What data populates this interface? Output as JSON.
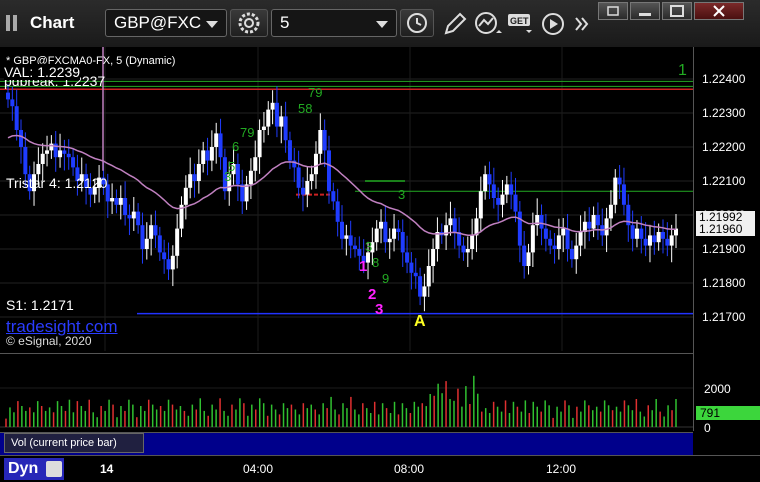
{
  "window": {
    "title": "Chart"
  },
  "toolbar": {
    "symbol": "GBP@FXC",
    "interval": "5"
  },
  "chart": {
    "title": "* GBP@FXCMA0-FX, 5 (Dynamic)",
    "labels": {
      "val": "VAL: 1.2239",
      "pdbreak": "pdbreak: 1.2237",
      "tristar": "Tristar 4: 1.2120",
      "s1": "S1: 1.2171",
      "brand": "tradesight.com",
      "copyright": "© eSignal, 2020",
      "marker_a": "A",
      "marker_1": "1",
      "marker_2": "2",
      "marker_3": "3",
      "green_marker": "1",
      "bar_count_marks": [
        "79",
        "58",
        "79",
        "6",
        "5",
        "3",
        "3",
        "8",
        "9",
        "3"
      ]
    },
    "price_ticks": [
      "1.22400",
      "1.22300",
      "1.22200",
      "1.22100",
      "1.22000",
      "1.21900",
      "1.21800",
      "1.21700"
    ],
    "last_price": "1.21960",
    "ma_price": "1.21992",
    "volume_ticks": [
      "2000",
      "0"
    ],
    "last_volume": "791",
    "volume_label": "Vol (current price bar)",
    "time_ticks": [
      "14",
      "04:00",
      "08:00",
      "12:00"
    ],
    "footer_label": "Dyn",
    "colors": {
      "up": "#ffffff",
      "down": "#1f3cff",
      "ma": "#c080c0",
      "resistance": "#cc2222",
      "support": "#2233ff",
      "green": "#22aa22",
      "magenta": "#ff22ff",
      "yellow": "#ffff22"
    }
  },
  "chart_data": {
    "type": "candlestick",
    "symbol": "GBP@FXCMA0-FX",
    "interval": "5",
    "ylim": [
      1.2165,
      1.2245
    ],
    "y_ticks": [
      1.224,
      1.223,
      1.222,
      1.221,
      1.22,
      1.219,
      1.218,
      1.217
    ],
    "levels": {
      "VAL": 1.2239,
      "pdbreak": 1.2237,
      "Tristar 4": 1.212,
      "S1": 1.2171
    },
    "last_price": 1.2196,
    "ma_last": 1.21992,
    "closes": [
      1.2234,
      1.2232,
      1.2225,
      1.222,
      1.2212,
      1.2207,
      1.2212,
      1.2215,
      1.2218,
      1.2219,
      1.2221,
      1.2217,
      1.2219,
      1.2218,
      1.2217,
      1.2214,
      1.221,
      1.2212,
      1.2208,
      1.2206,
      1.2208,
      1.2211,
      1.2209,
      1.2204,
      1.2205,
      1.2203,
      1.2205,
      1.22,
      1.2199,
      1.2201,
      1.2197,
      1.219,
      1.2193,
      1.2197,
      1.2194,
      1.2189,
      1.2187,
      1.2184,
      1.2188,
      1.2196,
      1.2203,
      1.2208,
      1.2212,
      1.221,
      1.2215,
      1.2219,
      1.2216,
      1.222,
      1.2224,
      1.2217,
      1.2207,
      1.2212,
      1.2215,
      1.2209,
      1.2204,
      1.2209,
      1.2213,
      1.2217,
      1.2225,
      1.2226,
      1.2231,
      1.2233,
      1.2226,
      1.2229,
      1.2222,
      1.2216,
      1.2214,
      1.2208,
      1.2206,
      1.221,
      1.2212,
      1.2218,
      1.2225,
      1.2219,
      1.2207,
      1.2204,
      1.2198,
      1.2193,
      1.2194,
      1.2191,
      1.219,
      1.2188,
      1.2186,
      1.2189,
      1.2192,
      1.2196,
      1.2198,
      1.2192,
      1.2193,
      1.2196,
      1.2195,
      1.2189,
      1.2186,
      1.2183,
      1.2182,
      1.2176,
      1.2179,
      1.2185,
      1.219,
      1.2195,
      1.2194,
      1.2197,
      1.2199,
      1.2195,
      1.2191,
      1.2189,
      1.219,
      1.2194,
      1.2199,
      1.2207,
      1.2212,
      1.2209,
      1.2205,
      1.2203,
      1.2206,
      1.2209,
      1.2206,
      1.2201,
      1.2191,
      1.2185,
      1.2189,
      1.2197,
      1.22,
      1.2196,
      1.2193,
      1.2191,
      1.219,
      1.2194,
      1.2196,
      1.219,
      1.2187,
      1.2191,
      1.2195,
      1.2198,
      1.2196,
      1.22,
      1.2197,
      1.2194,
      1.2199,
      1.2203,
      1.2211,
      1.2209,
      1.2203,
      1.2197,
      1.2193,
      1.2196,
      1.2193,
      1.2191,
      1.2194,
      1.2192,
      1.2195,
      1.2193,
      1.2191,
      1.2194,
      1.2196
    ]
  }
}
